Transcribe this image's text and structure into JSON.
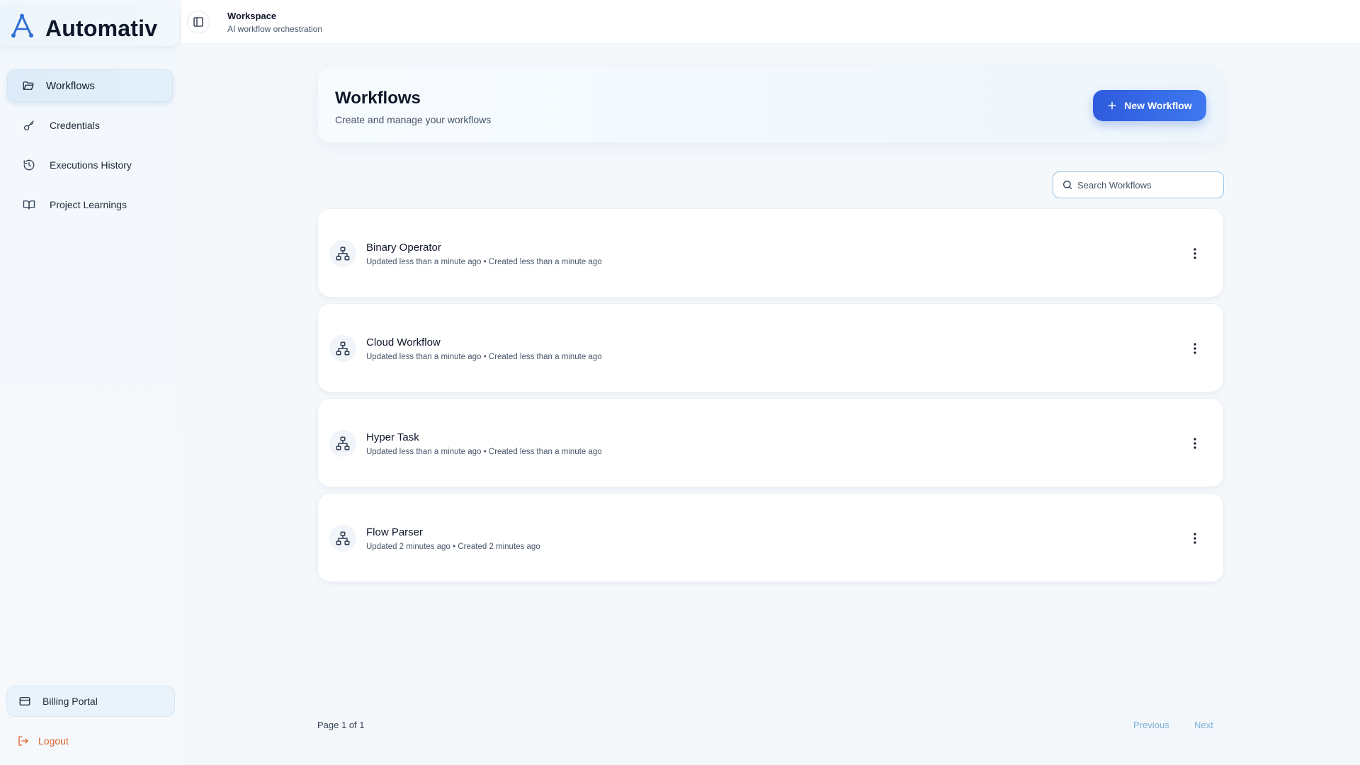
{
  "app": {
    "name": "Automativ",
    "accent": "#2e5bdc",
    "logout_color": "#d9622b"
  },
  "sidebar": {
    "items": [
      {
        "label": "Workflows",
        "icon": "folder-open-icon",
        "active": true
      },
      {
        "label": "Credentials",
        "icon": "key-icon",
        "active": false
      },
      {
        "label": "Executions History",
        "icon": "history-icon",
        "active": false
      },
      {
        "label": "Project Learnings",
        "icon": "book-open-icon",
        "active": false
      }
    ],
    "billing_label": "Billing Portal",
    "logout_label": "Logout"
  },
  "topbar": {
    "title": "Workspace",
    "subtitle": "AI workflow orchestration"
  },
  "header": {
    "title": "Workflows",
    "subtitle": "Create and manage your workflows",
    "new_button_label": "New Workflow"
  },
  "search": {
    "placeholder": "Search Workflows",
    "value": ""
  },
  "workflows": [
    {
      "name": "Binary Operator",
      "meta": "Updated less than a minute ago • Created less than a minute ago"
    },
    {
      "name": "Cloud Workflow",
      "meta": "Updated less than a minute ago • Created less than a minute ago"
    },
    {
      "name": "Hyper Task",
      "meta": "Updated less than a minute ago • Created less than a minute ago"
    },
    {
      "name": "Flow Parser",
      "meta": "Updated 2 minutes ago • Created 2 minutes ago"
    }
  ],
  "pagination": {
    "info": "Page 1 of 1",
    "previous_label": "Previous",
    "next_label": "Next"
  }
}
